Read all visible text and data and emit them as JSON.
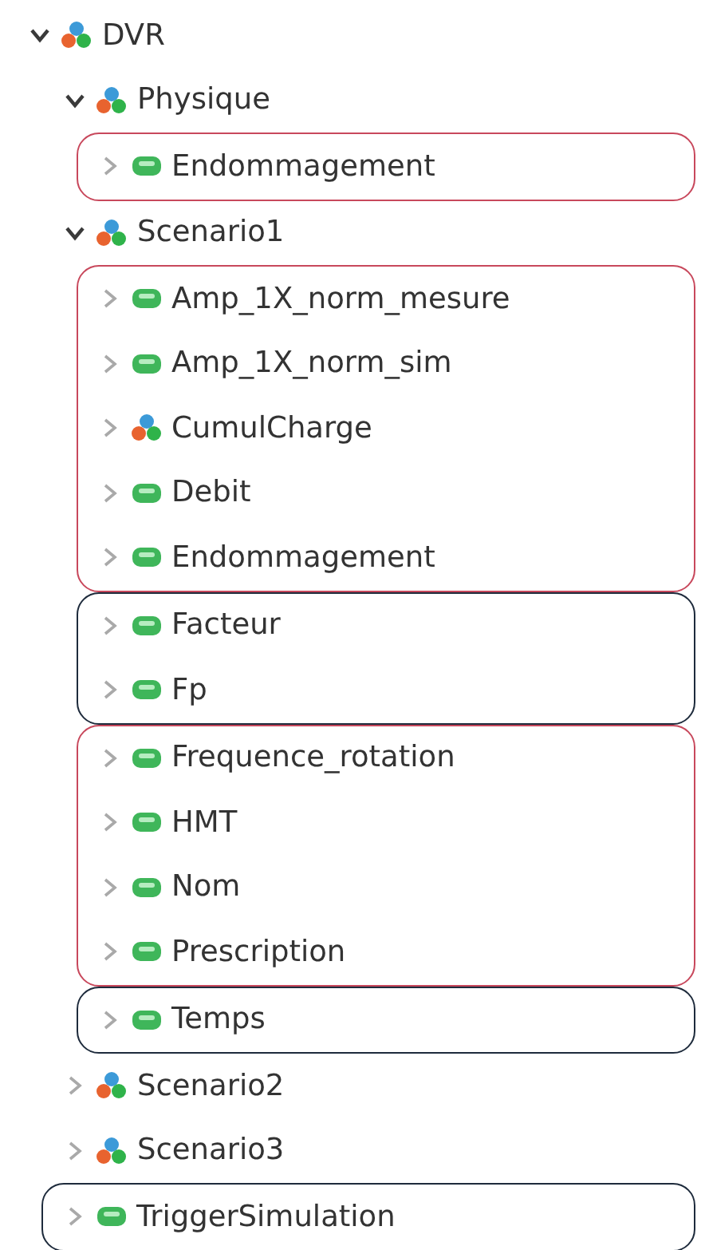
{
  "tree": [
    {
      "kind": "folder",
      "label": "DVR",
      "expanded": true,
      "children": [
        {
          "kind": "folder",
          "label": "Physique",
          "expanded": true,
          "children": [
            {
              "kind": "box",
              "color": "#c8485c",
              "children": [
                {
                  "kind": "variable",
                  "label": "Endommagement",
                  "expanded": false
                }
              ]
            }
          ]
        },
        {
          "kind": "folder",
          "label": "Scenario1",
          "expanded": true,
          "children": [
            {
              "kind": "box",
              "color": "#c8485c",
              "children": [
                {
                  "kind": "variable",
                  "label": "Amp_1X_norm_mesure",
                  "expanded": false
                },
                {
                  "kind": "variable",
                  "label": "Amp_1X_norm_sim",
                  "expanded": false
                },
                {
                  "kind": "folder",
                  "label": "CumulCharge",
                  "expanded": false
                },
                {
                  "kind": "variable",
                  "label": "Debit",
                  "expanded": false
                },
                {
                  "kind": "variable",
                  "label": "Endommagement",
                  "expanded": false
                }
              ]
            },
            {
              "kind": "box",
              "color": "#1e2b3c",
              "children": [
                {
                  "kind": "variable",
                  "label": "Facteur",
                  "expanded": false
                },
                {
                  "kind": "variable",
                  "label": "Fp",
                  "expanded": false
                }
              ]
            },
            {
              "kind": "box",
              "color": "#c8485c",
              "children": [
                {
                  "kind": "variable",
                  "label": "Frequence_rotation",
                  "expanded": false
                },
                {
                  "kind": "variable",
                  "label": "HMT",
                  "expanded": false
                },
                {
                  "kind": "variable",
                  "label": "Nom",
                  "expanded": false
                },
                {
                  "kind": "variable",
                  "label": "Prescription",
                  "expanded": false
                }
              ]
            },
            {
              "kind": "box",
              "color": "#1e2b3c",
              "children": [
                {
                  "kind": "variable",
                  "label": "Temps",
                  "expanded": false
                }
              ]
            }
          ]
        },
        {
          "kind": "folder",
          "label": "Scenario2",
          "expanded": false
        },
        {
          "kind": "folder",
          "label": "Scenario3",
          "expanded": false
        },
        {
          "kind": "box",
          "color": "#1e2b3c",
          "children": [
            {
              "kind": "variable",
              "label": "TriggerSimulation",
              "expanded": false
            }
          ]
        }
      ]
    }
  ]
}
